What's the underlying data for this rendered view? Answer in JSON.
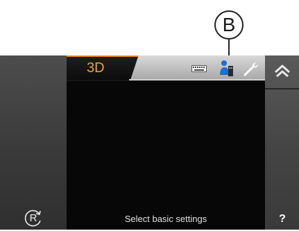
{
  "callout": {
    "label": "B"
  },
  "tabs": {
    "active_label": "3D"
  },
  "icons": {
    "keyboard": "keyboard-icon",
    "service": "service-person-icon",
    "wrench": "wrench-icon",
    "home": "home-up-icon",
    "reset": "reset-r-icon"
  },
  "reset_button": {
    "label": "R"
  },
  "help_button": {
    "label": "?"
  },
  "status": {
    "text": "Select basic settings"
  },
  "colors": {
    "accent": "#e58a1f",
    "screen": "#121212",
    "rail": "#4d4d4d"
  }
}
